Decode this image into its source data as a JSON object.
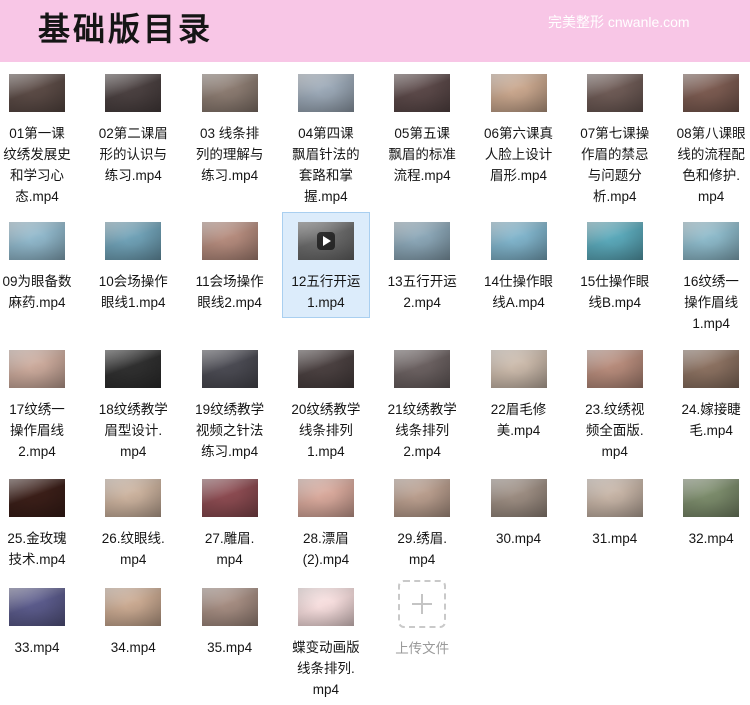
{
  "header": {
    "title": "基础版目录",
    "brand": "完美整形 cnwanle.com",
    "background_color": "#f8c6e6"
  },
  "files": [
    {
      "lines": [
        "01第一课",
        "纹绣发展史",
        "和学习心",
        "态.mp4"
      ],
      "thumb_color": "#5a4a45"
    },
    {
      "lines": [
        "02第二课眉",
        "形的认识与",
        "练习.mp4"
      ],
      "thumb_color": "#4a4040"
    },
    {
      "lines": [
        "03 线条排",
        "列的理解与",
        "练习.mp4"
      ],
      "thumb_color": "#8a7a70"
    },
    {
      "lines": [
        "04第四课",
        "飘眉针法的",
        "套路和掌",
        "握.mp4"
      ],
      "thumb_color": "#9aa7b5"
    },
    {
      "lines": [
        "05第五课",
        "飘眉的标准",
        "流程.mp4"
      ],
      "thumb_color": "#5a4848"
    },
    {
      "lines": [
        "06第六课真",
        "人脸上设计",
        "眉形.mp4"
      ],
      "thumb_color": "#c7a58c"
    },
    {
      "lines": [
        "07第七课操",
        "作眉的禁忌",
        "与问题分",
        "析.mp4"
      ],
      "thumb_color": "#6d5a55"
    },
    {
      "lines": [
        "08第八课眼",
        "线的流程配",
        "色和修护.",
        "mp4"
      ],
      "thumb_color": "#7a5a50"
    },
    {
      "lines": [
        "09为眼备数",
        "麻药.mp4"
      ],
      "thumb_color": "#8fb6c9"
    },
    {
      "lines": [
        "10会场操作",
        "眼线1.mp4"
      ],
      "thumb_color": "#6fa0b5"
    },
    {
      "lines": [
        "11会场操作",
        "眼线2.mp4"
      ],
      "thumb_color": "#b38a7c"
    },
    {
      "lines": [
        "12五行开运",
        "1.mp4"
      ],
      "thumb_color": "#6a6a6a",
      "selected": true,
      "overlay_icon": "play-icon"
    },
    {
      "lines": [
        "13五行开运",
        "2.mp4"
      ],
      "thumb_color": "#8aa5b5"
    },
    {
      "lines": [
        "14仕操作眼",
        "线A.mp4"
      ],
      "thumb_color": "#7fb2c9"
    },
    {
      "lines": [
        "15仕操作眼",
        "线B.mp4"
      ],
      "thumb_color": "#5aa7b8"
    },
    {
      "lines": [
        "16纹绣一",
        "操作眉线",
        "1.mp4"
      ],
      "thumb_color": "#8cb8c8"
    },
    {
      "lines": [
        "17纹绣一",
        "操作眉线",
        "2.mp4"
      ],
      "thumb_color": "#c9a89a"
    },
    {
      "lines": [
        "18纹绣教学",
        "眉型设计.",
        "mp4"
      ],
      "thumb_color": "#2f2f2f"
    },
    {
      "lines": [
        "19纹绣教学",
        "视频之针法",
        "练习.mp4"
      ],
      "thumb_color": "#4a4a52"
    },
    {
      "lines": [
        "20纹绣教学",
        "线条排列",
        "1.mp4"
      ],
      "thumb_color": "#4a4040"
    },
    {
      "lines": [
        "21纹绣教学",
        "线条排列",
        "2.mp4"
      ],
      "thumb_color": "#6a6060"
    },
    {
      "lines": [
        "22眉毛修",
        "美.mp4"
      ],
      "thumb_color": "#c9b8a9"
    },
    {
      "lines": [
        "23.纹绣视",
        "频全面版.",
        "mp4"
      ],
      "thumb_color": "#b58a7a"
    },
    {
      "lines": [
        "24.嫁接睫",
        "毛.mp4"
      ],
      "thumb_color": "#8a7060"
    },
    {
      "lines": [
        "25.金玫瑰",
        "技术.mp4"
      ],
      "thumb_color": "#3a1e18"
    },
    {
      "lines": [
        "26.纹眼线.",
        "mp4"
      ],
      "thumb_color": "#c9b09c"
    },
    {
      "lines": [
        "27.雕眉.",
        "mp4"
      ],
      "thumb_color": "#8a4a50"
    },
    {
      "lines": [
        "28.漂眉",
        "(2).mp4"
      ],
      "thumb_color": "#d6a79a"
    },
    {
      "lines": [
        "29.绣眉.",
        "mp4"
      ],
      "thumb_color": "#b79c8c"
    },
    {
      "lines": [
        "30.mp4"
      ],
      "thumb_color": "#9a8b80"
    },
    {
      "lines": [
        "31.mp4"
      ],
      "thumb_color": "#c4b2a4"
    },
    {
      "lines": [
        "32.mp4"
      ],
      "thumb_color": "#7a8a6a"
    },
    {
      "lines": [
        "33.mp4"
      ],
      "thumb_color": "#5a5a8a"
    },
    {
      "lines": [
        "34.mp4"
      ],
      "thumb_color": "#c8a890"
    },
    {
      "lines": [
        "35.mp4"
      ],
      "thumb_color": "#a38b80"
    },
    {
      "lines": [
        "蝶变动画版",
        "线条排列.",
        "mp4"
      ],
      "thumb_color": "#f5dcdc"
    }
  ],
  "upload": {
    "label": "上传文件",
    "icon": "plus-icon"
  },
  "colors": {
    "selection_fill": "#dcecfb",
    "selection_border": "#a9cff0",
    "upload_text": "#9a9a9a"
  }
}
